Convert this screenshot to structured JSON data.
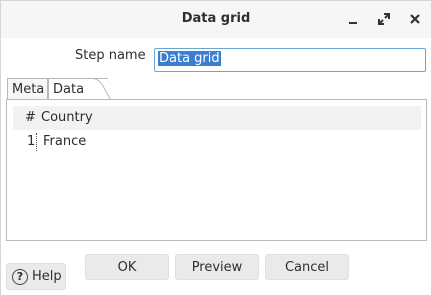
{
  "window": {
    "title": "Data grid"
  },
  "form": {
    "step_name_label": "Step name",
    "step_name_value": "Data grid"
  },
  "tabs": [
    {
      "label": "Meta",
      "active": false
    },
    {
      "label": "Data",
      "active": true
    }
  ],
  "grid": {
    "headers": {
      "num": "#",
      "country": "Country"
    },
    "rows": [
      {
        "num": "1",
        "country": "France"
      }
    ]
  },
  "buttons": {
    "ok": "OK",
    "preview": "Preview",
    "cancel": "Cancel",
    "help": "Help"
  },
  "icons": {
    "minimize": "minimize-icon",
    "maximize": "maximize-icon",
    "close": "close-icon",
    "help": "help-icon"
  },
  "colors": {
    "selection": "#3a7fd0",
    "input_border": "#6aa7d6"
  }
}
